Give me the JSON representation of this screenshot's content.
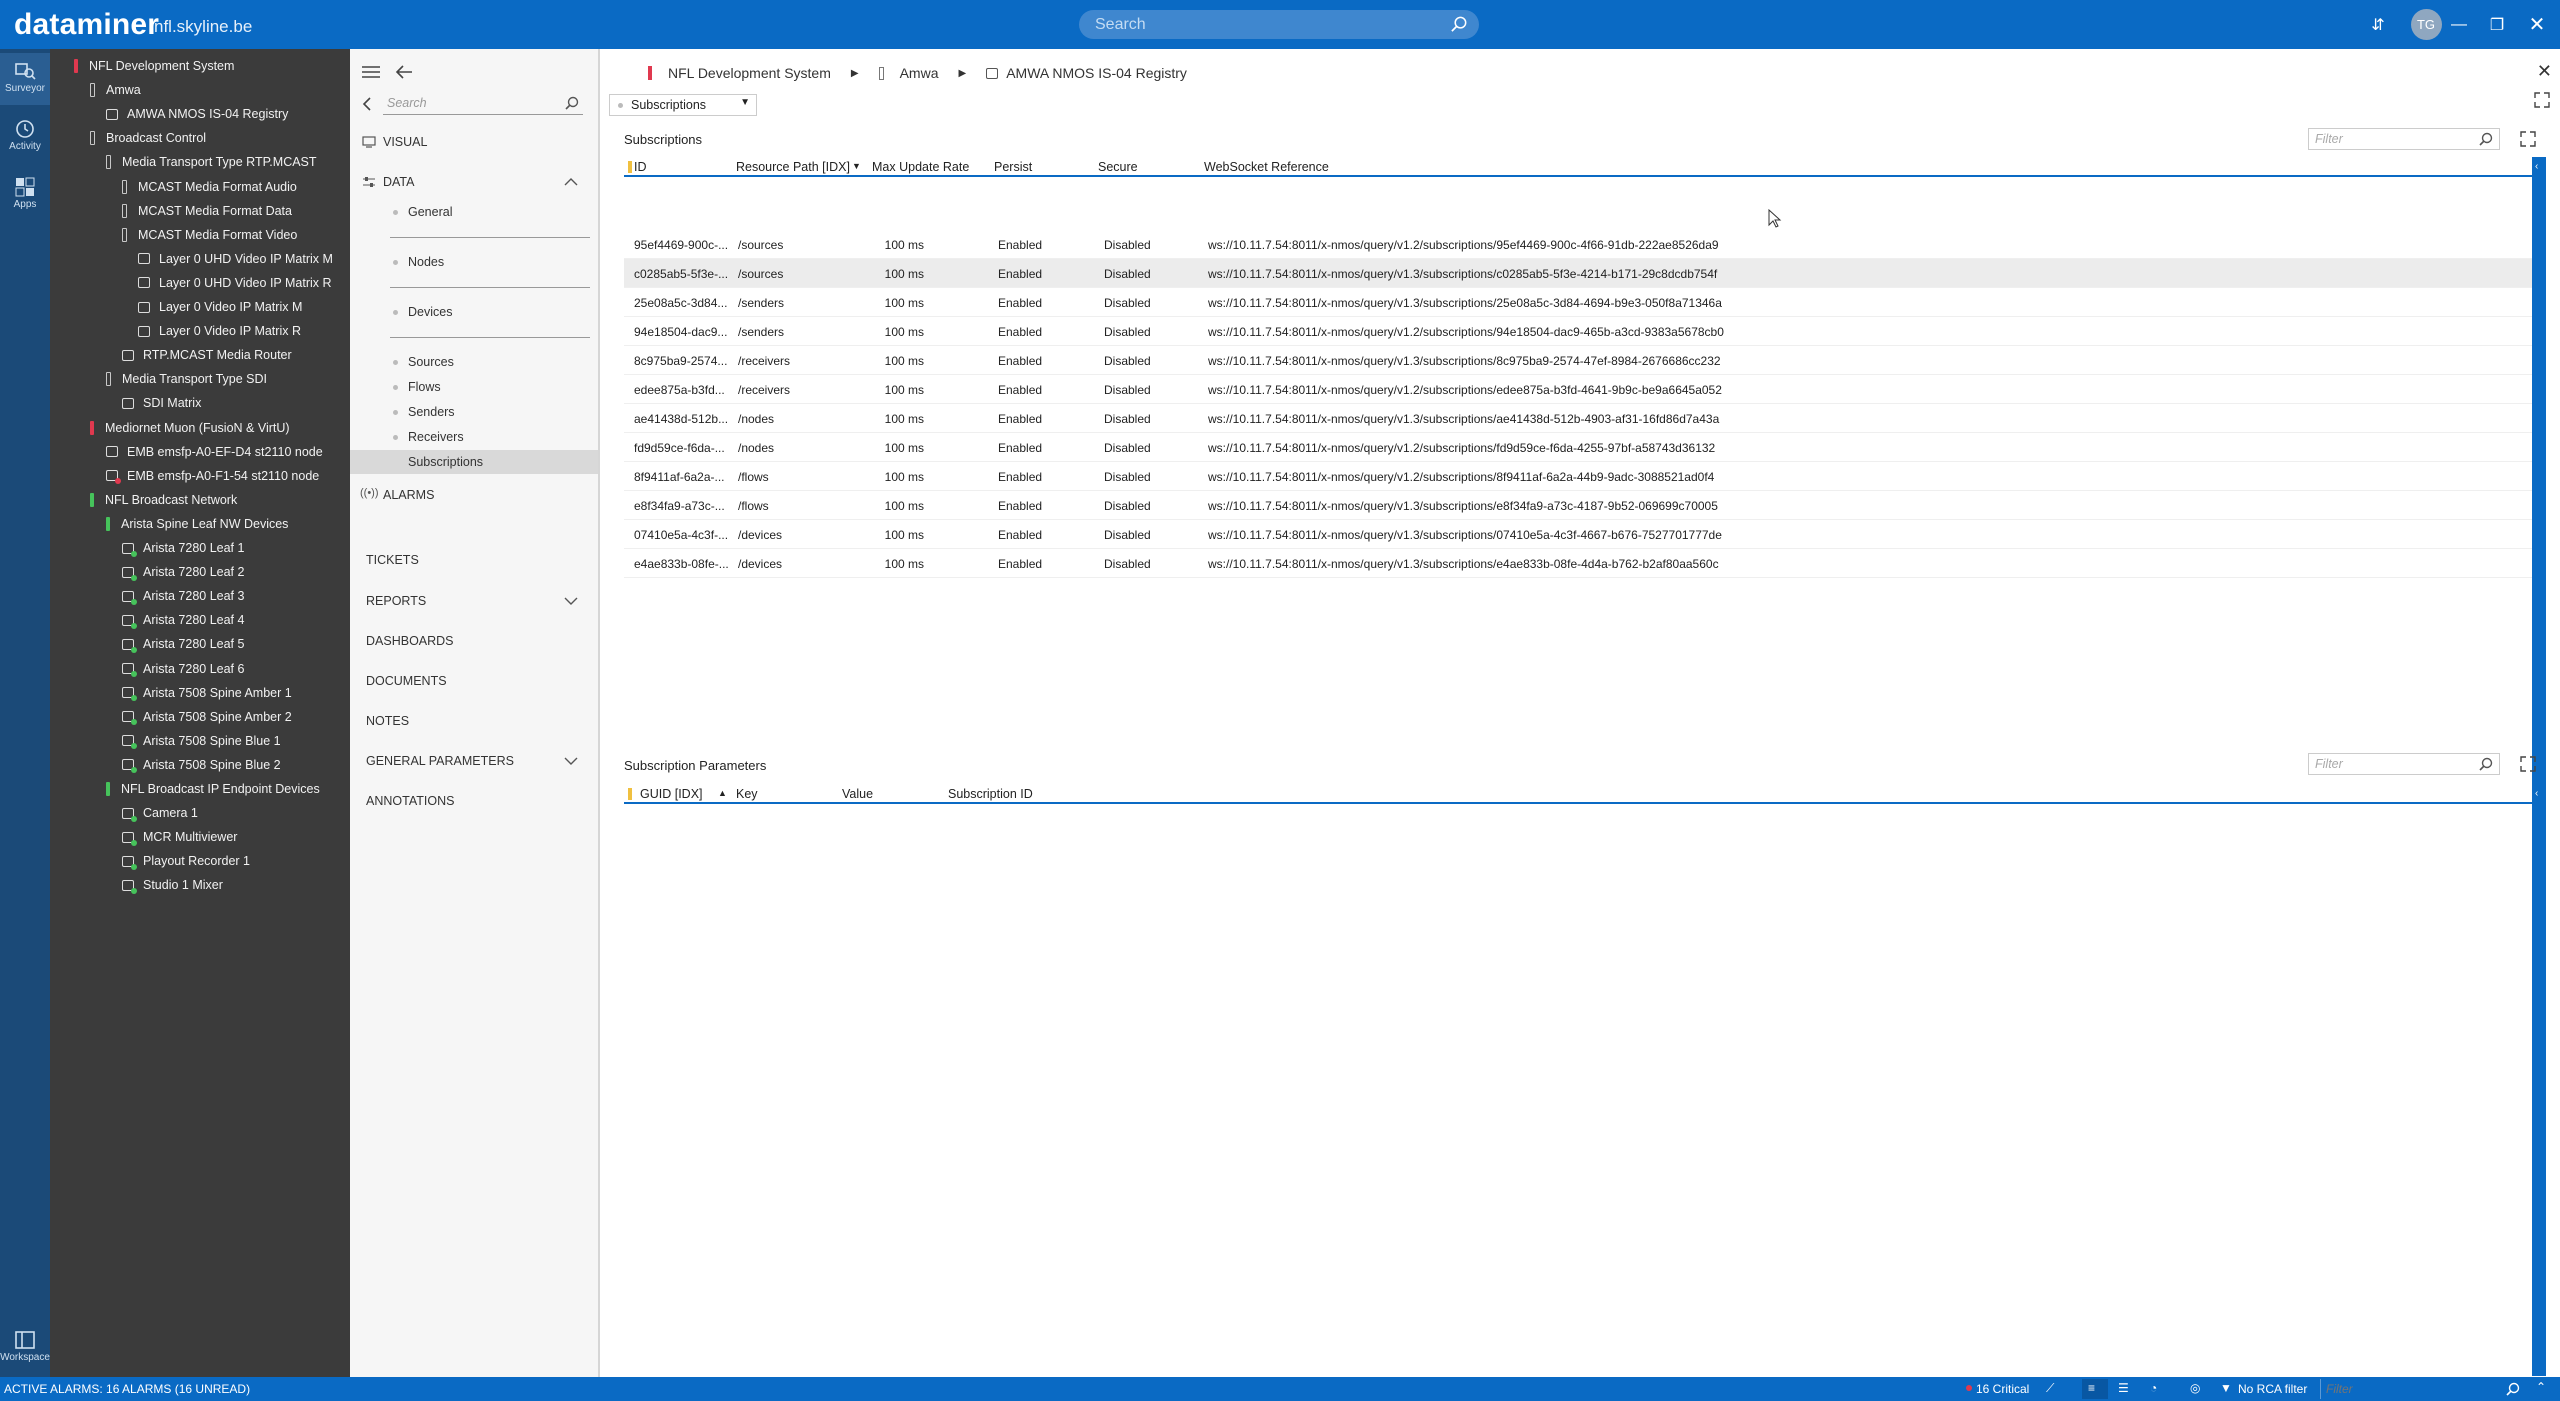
{
  "app": {
    "brand": "dataminer",
    "host": "nfl.skyline.be"
  },
  "search": {
    "placeholder": "Search"
  },
  "user": {
    "initials": "TG"
  },
  "rail": [
    {
      "label": "Surveyor"
    },
    {
      "label": "Activity"
    },
    {
      "label": "Apps"
    },
    {
      "label": "Workspace"
    }
  ],
  "tree": [
    {
      "label": "NFL Development System",
      "indent": 0,
      "sev": "red"
    },
    {
      "label": "Amwa",
      "indent": 1,
      "sev": "none"
    },
    {
      "label": "AMWA NMOS IS-04 Registry",
      "indent": 2,
      "sev": "elem"
    },
    {
      "label": "Broadcast Control",
      "indent": 1,
      "sev": "none"
    },
    {
      "label": "Media Transport Type RTP.MCAST",
      "indent": 2,
      "sev": "none"
    },
    {
      "label": "MCAST Media Format Audio",
      "indent": 3,
      "sev": "none"
    },
    {
      "label": "MCAST Media Format Data",
      "indent": 3,
      "sev": "none"
    },
    {
      "label": "MCAST Media Format Video",
      "indent": 3,
      "sev": "none"
    },
    {
      "label": "Layer 0 UHD Video IP Matrix M",
      "indent": 4,
      "sev": "elem"
    },
    {
      "label": "Layer 0 UHD Video IP Matrix R",
      "indent": 4,
      "sev": "elem"
    },
    {
      "label": "Layer 0 Video IP Matrix M",
      "indent": 4,
      "sev": "elem"
    },
    {
      "label": "Layer 0 Video IP Matrix R",
      "indent": 4,
      "sev": "elem"
    },
    {
      "label": "RTP.MCAST Media Router",
      "indent": 3,
      "sev": "elem"
    },
    {
      "label": "Media Transport Type SDI",
      "indent": 2,
      "sev": "none"
    },
    {
      "label": "SDI Matrix",
      "indent": 3,
      "sev": "elem"
    },
    {
      "label": "Mediornet Muon (FusioN & VirtU)",
      "indent": 1,
      "sev": "red"
    },
    {
      "label": "EMB emsfp-A0-EF-D4 st2110 node",
      "indent": 2,
      "sev": "elem"
    },
    {
      "label": "EMB emsfp-A0-F1-54 st2110 node",
      "indent": 2,
      "sev": "elemred"
    },
    {
      "label": "NFL Broadcast Network",
      "indent": 1,
      "sev": "green"
    },
    {
      "label": "Arista Spine Leaf NW Devices",
      "indent": 2,
      "sev": "green"
    },
    {
      "label": "Arista 7280 Leaf 1",
      "indent": 3,
      "sev": "elemgreen"
    },
    {
      "label": "Arista 7280 Leaf 2",
      "indent": 3,
      "sev": "elemgreen"
    },
    {
      "label": "Arista 7280 Leaf 3",
      "indent": 3,
      "sev": "elemgreen"
    },
    {
      "label": "Arista 7280 Leaf 4",
      "indent": 3,
      "sev": "elemgreen"
    },
    {
      "label": "Arista 7280 Leaf 5",
      "indent": 3,
      "sev": "elemgreen"
    },
    {
      "label": "Arista 7280 Leaf 6",
      "indent": 3,
      "sev": "elemgreen"
    },
    {
      "label": "Arista 7508 Spine Amber 1",
      "indent": 3,
      "sev": "elemgreen"
    },
    {
      "label": "Arista 7508 Spine Amber 2",
      "indent": 3,
      "sev": "elemgreen"
    },
    {
      "label": "Arista 7508 Spine Blue 1",
      "indent": 3,
      "sev": "elemgreen"
    },
    {
      "label": "Arista 7508 Spine Blue 2",
      "indent": 3,
      "sev": "elemgreen"
    },
    {
      "label": "NFL Broadcast IP Endpoint Devices",
      "indent": 2,
      "sev": "green"
    },
    {
      "label": "Camera 1",
      "indent": 3,
      "sev": "elemgreen"
    },
    {
      "label": "MCR Multiviewer",
      "indent": 3,
      "sev": "elemgreen"
    },
    {
      "label": "Playout Recorder 1",
      "indent": 3,
      "sev": "elemgreen"
    },
    {
      "label": "Studio 1 Mixer",
      "indent": 3,
      "sev": "elemgreen"
    }
  ],
  "nav": {
    "search_placeholder": "Search",
    "visual": "VISUAL",
    "data": "DATA",
    "general": "General",
    "nodes": "Nodes",
    "devices": "Devices",
    "sources": "Sources",
    "flows": "Flows",
    "senders": "Senders",
    "receivers": "Receivers",
    "subscriptions": "Subscriptions",
    "alarms": "ALARMS",
    "tickets": "TICKETS",
    "reports": "REPORTS",
    "dashboards": "DASHBOARDS",
    "documents": "DOCUMENTS",
    "notes": "NOTES",
    "general_parameters": "GENERAL PARAMETERS",
    "annotations": "ANNOTATIONS"
  },
  "breadcrumb": {
    "view": "NFL Development System",
    "sub": "Amwa",
    "element": "AMWA NMOS IS-04 Registry"
  },
  "page_combo": "Subscriptions",
  "subscriptions": {
    "title": "Subscriptions",
    "filter_placeholder": "Filter",
    "columns": [
      "ID",
      "Resource Path [IDX]",
      "Max Update Rate",
      "Persist",
      "Secure",
      "WebSocket Reference"
    ],
    "rows": [
      [
        "95ef4469-900c-...",
        "/sources",
        "100 ms",
        "Enabled",
        "Disabled",
        "ws://10.11.7.54:8011/x-nmos/query/v1.2/subscriptions/95ef4469-900c-4f66-91db-222ae8526da9"
      ],
      [
        "c0285ab5-5f3e-...",
        "/sources",
        "100 ms",
        "Enabled",
        "Disabled",
        "ws://10.11.7.54:8011/x-nmos/query/v1.3/subscriptions/c0285ab5-5f3e-4214-b171-29c8dcdb754f"
      ],
      [
        "25e08a5c-3d84...",
        "/senders",
        "100 ms",
        "Enabled",
        "Disabled",
        "ws://10.11.7.54:8011/x-nmos/query/v1.3/subscriptions/25e08a5c-3d84-4694-b9e3-050f8a71346a"
      ],
      [
        "94e18504-dac9...",
        "/senders",
        "100 ms",
        "Enabled",
        "Disabled",
        "ws://10.11.7.54:8011/x-nmos/query/v1.2/subscriptions/94e18504-dac9-465b-a3cd-9383a5678cb0"
      ],
      [
        "8c975ba9-2574...",
        "/receivers",
        "100 ms",
        "Enabled",
        "Disabled",
        "ws://10.11.7.54:8011/x-nmos/query/v1.3/subscriptions/8c975ba9-2574-47ef-8984-2676686cc232"
      ],
      [
        "edee875a-b3fd...",
        "/receivers",
        "100 ms",
        "Enabled",
        "Disabled",
        "ws://10.11.7.54:8011/x-nmos/query/v1.2/subscriptions/edee875a-b3fd-4641-9b9c-be9a6645a052"
      ],
      [
        "ae41438d-512b...",
        "/nodes",
        "100 ms",
        "Enabled",
        "Disabled",
        "ws://10.11.7.54:8011/x-nmos/query/v1.3/subscriptions/ae41438d-512b-4903-af31-16fd86d7a43a"
      ],
      [
        "fd9d59ce-f6da-...",
        "/nodes",
        "100 ms",
        "Enabled",
        "Disabled",
        "ws://10.11.7.54:8011/x-nmos/query/v1.2/subscriptions/fd9d59ce-f6da-4255-97bf-a58743d36132"
      ],
      [
        "8f9411af-6a2a-...",
        "/flows",
        "100 ms",
        "Enabled",
        "Disabled",
        "ws://10.11.7.54:8011/x-nmos/query/v1.2/subscriptions/8f9411af-6a2a-44b9-9adc-3088521ad0f4"
      ],
      [
        "e8f34fa9-a73c-...",
        "/flows",
        "100 ms",
        "Enabled",
        "Disabled",
        "ws://10.11.7.54:8011/x-nmos/query/v1.3/subscriptions/e8f34fa9-a73c-4187-9b52-069699c70005"
      ],
      [
        "07410e5a-4c3f-...",
        "/devices",
        "100 ms",
        "Enabled",
        "Disabled",
        "ws://10.11.7.54:8011/x-nmos/query/v1.3/subscriptions/07410e5a-4c3f-4667-b676-7527701777de"
      ],
      [
        "e4ae833b-08fe-...",
        "/devices",
        "100 ms",
        "Enabled",
        "Disabled",
        "ws://10.11.7.54:8011/x-nmos/query/v1.3/subscriptions/e4ae833b-08fe-4d4a-b762-b2af80aa560c"
      ]
    ]
  },
  "params": {
    "title": "Subscription Parameters",
    "filter_placeholder": "Filter",
    "columns": [
      "GUID [IDX]",
      "Key",
      "Value",
      "Subscription ID"
    ]
  },
  "status": {
    "alarms": "ACTIVE ALARMS: 16 ALARMS (16 UNREAD)",
    "critical": "16 Critical",
    "rca": "No RCA filter",
    "filter_placeholder": "Filter"
  },
  "colors": {
    "accent": "#0a6ac4",
    "critical": "#e0394f",
    "ok": "#46c35b"
  }
}
